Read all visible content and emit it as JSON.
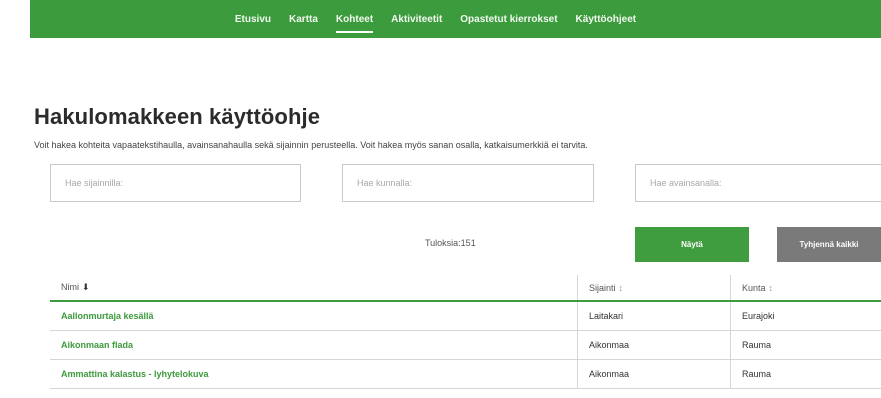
{
  "nav": {
    "items": [
      {
        "label": "Etusivu",
        "active": false
      },
      {
        "label": "Kartta",
        "active": false
      },
      {
        "label": "Kohteet",
        "active": true
      },
      {
        "label": "Aktiviteetit",
        "active": false
      },
      {
        "label": "Opastetut kierrokset",
        "active": false
      },
      {
        "label": "Käyttöohjeet",
        "active": false
      }
    ],
    "color": "#3c9b3c"
  },
  "page": {
    "title": "Hakulomakkeen käyttöohje",
    "intro": "Voit hakea kohteita vapaatekstihaulla, avainsanahaulla sekä sijainnin perusteella. Voit hakea myös sanan osalla, katkaisumerkkiä ei tarvita."
  },
  "search": {
    "location_placeholder": "Hae sijainnilla:",
    "municipality_placeholder": "Hae kunnalla:",
    "keyword_placeholder": "Hae avainsanalla:"
  },
  "results": {
    "count_text": "Tuloksia:151",
    "show_label": "Näytä",
    "clear_label": "Tyhjennä kaikki",
    "headers": {
      "name": "Nimi",
      "name_sort": "⬇",
      "location": "Sijainti",
      "location_sort": "↕",
      "municipality": "Kunta",
      "municipality_sort": "↕"
    },
    "rows": [
      {
        "name": "Aallonmurtaja kesällä",
        "location": "Laitakari",
        "municipality": "Eurajoki"
      },
      {
        "name": "Aikonmaan flada",
        "location": "Aikonmaa",
        "municipality": "Rauma"
      },
      {
        "name": "Ammattina kalastus - lyhytelokuva",
        "location": "Aikonmaa",
        "municipality": "Rauma"
      }
    ]
  },
  "colors": {
    "accent": "#3c9b3c",
    "clear_button": "#7a7a7a",
    "link": "#3d9a3d"
  }
}
